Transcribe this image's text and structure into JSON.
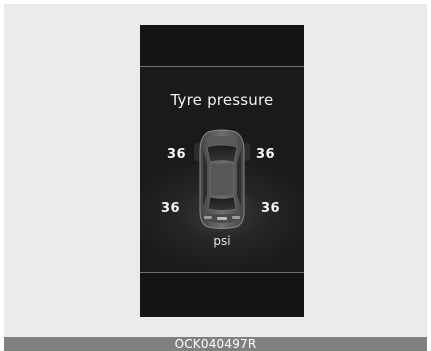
{
  "screen": {
    "title": "Tyre pressure",
    "unit": "psi"
  },
  "tyres": {
    "front_left": "36",
    "front_right": "36",
    "rear_left": "36",
    "rear_right": "36"
  },
  "footer": {
    "code": "OCK040497R"
  },
  "colors": {
    "background": "#ebebeb",
    "cluster": "#151515",
    "text": "#f5f5f5",
    "footer": "#808080"
  },
  "icons": {
    "car": "car-top-view-icon"
  }
}
